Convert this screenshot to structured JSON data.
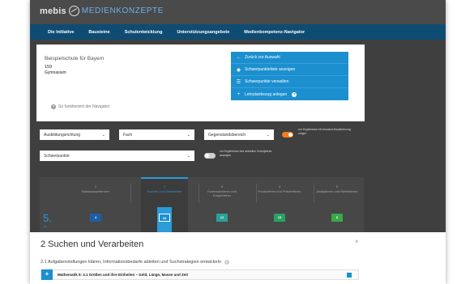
{
  "header": {
    "logo_text": "mebis",
    "brand_subtitle": "MEDIENKONZEPTE"
  },
  "nav": [
    "Die Initiative",
    "Bausteine",
    "Schulentwicklung",
    "Unterstützungsangebote",
    "Medienkompetenz-Navigator"
  ],
  "school": {
    "name": "Beispielschule für Bayern",
    "number": "159",
    "type": "Gymnasium",
    "functions_link": "So funktioniert der Navigator"
  },
  "actions": [
    {
      "icon": "arrow-left-icon",
      "glyph": "←",
      "label": "Zurück zur Auswahl"
    },
    {
      "icon": "eye-icon",
      "glyph": "◉",
      "label": "Schwerpunkteliste anzeigen"
    },
    {
      "icon": "list-icon",
      "glyph": "☰",
      "label": "Schwerpunkte verwalten"
    },
    {
      "icon": "plus-icon",
      "glyph": "+",
      "label": "Lehrplanbezug anlegen",
      "help": "?"
    }
  ],
  "filters": {
    "jahrgangsstufe": "Ausbildungsrichtung",
    "fach": "Fach",
    "gegenstandsbereich": "Gegenstandsbereich",
    "schwerpunkte": "Schwerpunkte",
    "toggle1_label": "nur Ergebnisse mit Ansatz/Lehrplanbezug zeigen",
    "toggle1_on": true,
    "toggle2_label": "nur Ergebnisse des aktuellen Schuljahres anzeigen",
    "toggle2_on": false
  },
  "grid": {
    "columns": [
      {
        "n": "1",
        "label": "Basiskompetenzen",
        "active": false
      },
      {
        "n": "2",
        "label": "Suchen und Verarbeiten",
        "active": true
      },
      {
        "n": "3",
        "label": "Kommunizieren und Kooperieren",
        "active": false
      },
      {
        "n": "4",
        "label": "Produzieren und Präsentieren",
        "active": false
      },
      {
        "n": "5",
        "label": "Analysieren und Reflektieren",
        "active": false
      }
    ],
    "class_number": "5.",
    "class_label": "Kl.",
    "tiles": [
      {
        "text": "4",
        "color": "#1c5fa8"
      },
      {
        "text": "16",
        "color": "#2b9bd9"
      },
      {
        "text": "12",
        "color": "#2aa198"
      },
      {
        "text": "15",
        "color": "#2aa162"
      },
      {
        "text": "8",
        "color": "#3aa84a"
      }
    ]
  },
  "panel": {
    "title": "2 Suchen und Verarbeiten",
    "close": "×",
    "subtitle": "2.1   Aufgabenstellungen klären, Informationsbedarfe ableiten und Suchstrategien entwickeln",
    "entry": "Mathematik 5: 4.1 Größen und ihre Einheiten – Geld, Länge, Masse und Zeit",
    "entry_plus": "+"
  },
  "colors": {
    "nav_bg": "#0f4c73",
    "accent_blue": "#1c8fcf",
    "toggle_on": "#f07c22"
  }
}
